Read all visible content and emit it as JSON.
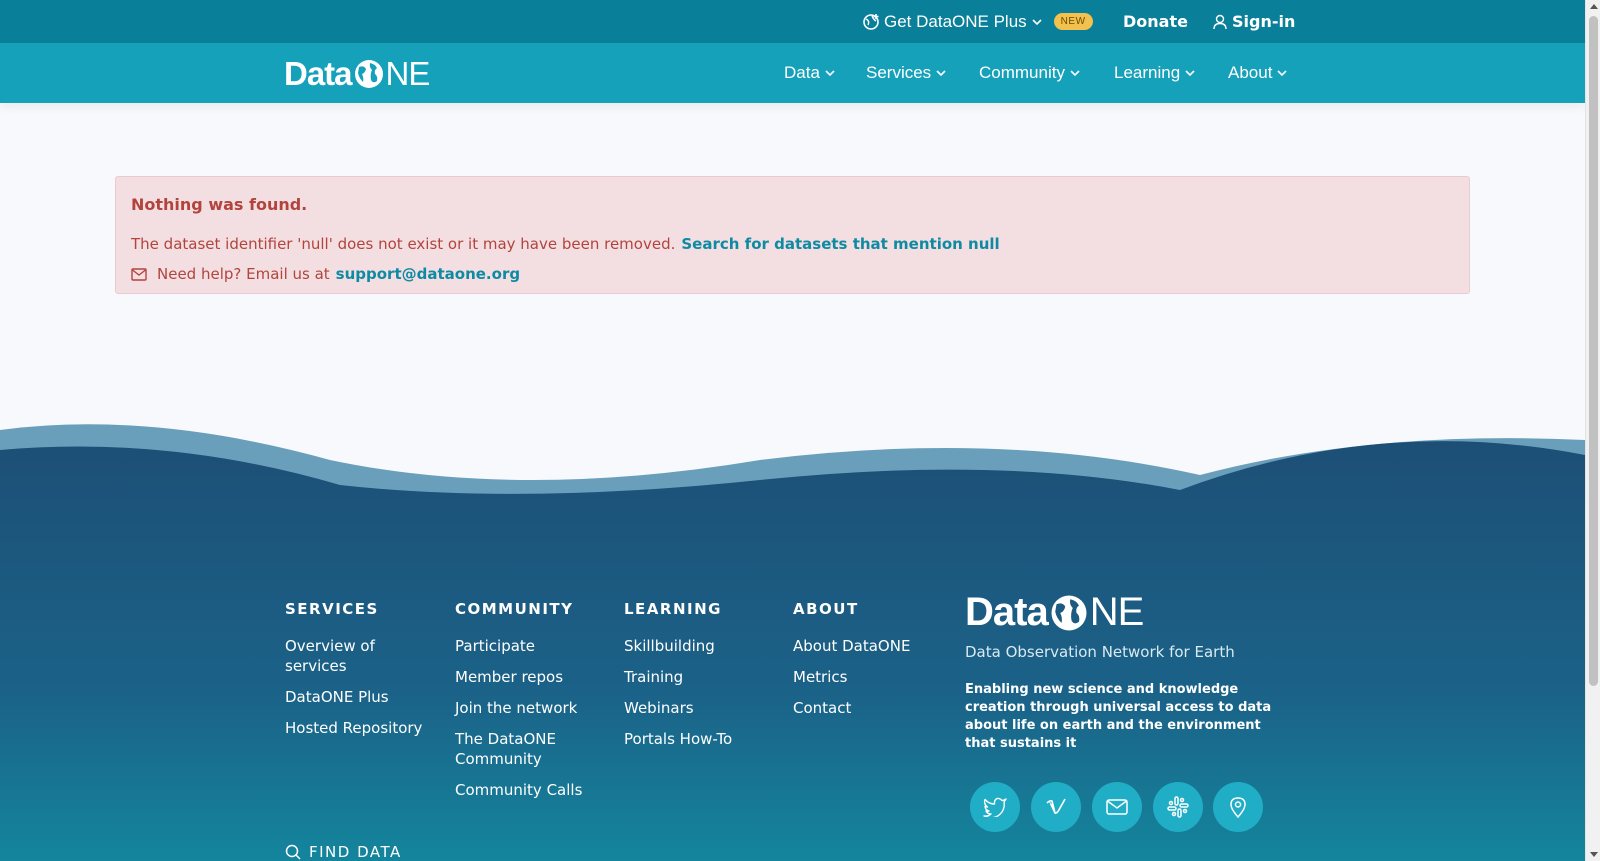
{
  "utility": {
    "plus_label": "Get DataONE Plus",
    "new_badge": "NEW",
    "donate": "Donate",
    "signin": "Sign-in"
  },
  "logo": {
    "data": "Data",
    "one": "ONE"
  },
  "nav": {
    "items": [
      {
        "label": "Data"
      },
      {
        "label": "Services"
      },
      {
        "label": "Community"
      },
      {
        "label": "Learning"
      },
      {
        "label": "About"
      }
    ]
  },
  "alert": {
    "title": "Nothing was found.",
    "message": "The dataset identifier 'null' does not exist or it may have been removed.",
    "search_link": "Search for datasets that mention null",
    "help_prefix": "Need help? Email us at",
    "email": "support@dataone.org"
  },
  "footer": {
    "services": {
      "heading": "SERVICES",
      "links": [
        "Overview of services",
        "DataONE Plus",
        "Hosted Repository"
      ]
    },
    "community": {
      "heading": "COMMUNITY",
      "links": [
        "Participate",
        "Member repos",
        "Join the network",
        "The DataONE Community",
        "Community Calls"
      ]
    },
    "learning": {
      "heading": "LEARNING",
      "links": [
        "Skillbuilding",
        "Training",
        "Webinars",
        "Portals How-To"
      ]
    },
    "about": {
      "heading": "ABOUT",
      "links": [
        "About DataONE",
        "Metrics",
        "Contact"
      ]
    },
    "brand": {
      "tagline": "Data Observation Network for Earth",
      "mission": "Enabling new science and knowledge creation through universal access to data about life on earth and the environment that sustains it"
    },
    "find_data": "FIND DATA",
    "social_icons": [
      "twitter-icon",
      "vimeo-icon",
      "mail-icon",
      "slack-icon",
      "location-icon"
    ]
  },
  "colors": {
    "utility_bar": "#0a7f99",
    "nav_bar": "#15a1ba",
    "alert_bg": "#f3dfe1",
    "alert_text": "#b2443d",
    "link": "#0f8aa3",
    "footer_dark": "#1b5a82",
    "wave_light": "#6a9fbc"
  }
}
